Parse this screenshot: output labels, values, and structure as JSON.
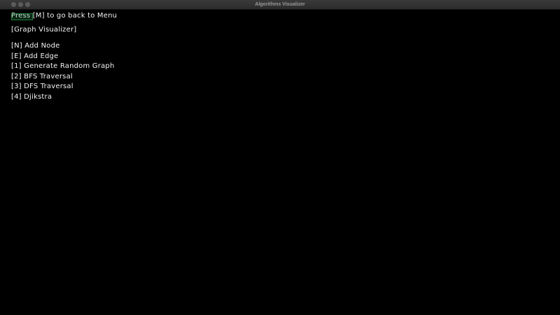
{
  "window": {
    "title": "Algorithms Visualizer"
  },
  "back_hint": {
    "prefix": "Press ",
    "key": "[M]",
    "suffix": " to go back to Menu"
  },
  "heading": "[Graph Visualizer]",
  "menu": [
    "[N] Add Node",
    "[E] Add Edge",
    "[1] Generate Random Graph",
    "[2] BFS Traversal",
    "[3] DFS Traversal",
    "[4] Djikstra"
  ],
  "colors": {
    "background": "#000000",
    "text": "#f2f2f2",
    "titlebar": "#2c2c2c",
    "highlight": "#1f7a3a"
  }
}
